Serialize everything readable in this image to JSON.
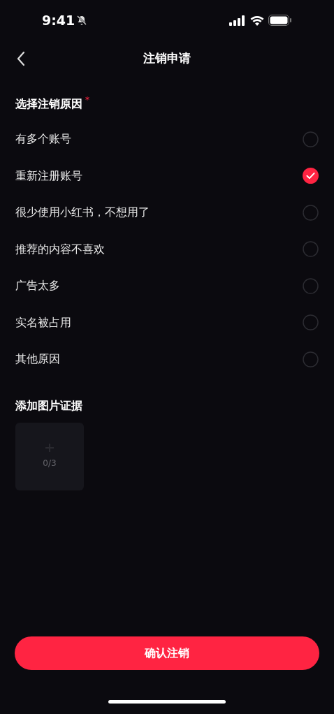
{
  "status_bar": {
    "time": "9:41"
  },
  "header": {
    "title": "注销申请"
  },
  "reasons": {
    "title": "选择注销原因",
    "required_mark": "*",
    "options": [
      {
        "label": "有多个账号",
        "selected": false
      },
      {
        "label": "重新注册账号",
        "selected": true
      },
      {
        "label": "很少使用小红书，不想用了",
        "selected": false
      },
      {
        "label": "推荐的内容不喜欢",
        "selected": false
      },
      {
        "label": "广告太多",
        "selected": false
      },
      {
        "label": "实名被占用",
        "selected": false
      },
      {
        "label": "其他原因",
        "selected": false
      }
    ]
  },
  "evidence": {
    "title": "添加图片证据",
    "count": "0/3"
  },
  "confirm_button": "确认注销"
}
